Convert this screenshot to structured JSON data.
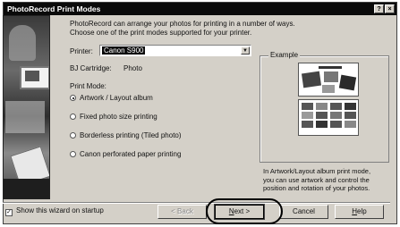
{
  "window": {
    "title": "PhotoRecord Print Modes",
    "help_glyph": "?",
    "close_glyph": "×"
  },
  "intro": {
    "line1": "PhotoRecord can arrange your photos for printing in a number of ways.",
    "line2": "Choose one of the print modes supported for your printer."
  },
  "printer": {
    "label": "Printer:",
    "value": "Canon S900",
    "arrow_glyph": "▼"
  },
  "cartridge": {
    "label": "BJ Cartridge:",
    "value": "Photo"
  },
  "print_mode": {
    "label": "Print Mode:",
    "options": [
      {
        "label": "Artwork / Layout album",
        "selected": true
      },
      {
        "label": "Fixed photo size printing",
        "selected": false
      },
      {
        "label": "Borderless printing (Tiled photo)",
        "selected": false
      },
      {
        "label": "Canon perforated paper printing",
        "selected": false
      }
    ]
  },
  "example": {
    "legend": "Example",
    "thumb_title_text": "",
    "explanation": [
      "In Artwork/Layout album print mode,",
      "you can use artwork and control the",
      "position and rotation of your photos."
    ]
  },
  "footer": {
    "show_wizard_label": "Show this wizard on startup",
    "show_wizard_checked": true,
    "check_glyph": "✓"
  },
  "buttons": {
    "back": "< Back",
    "next_prefix": "",
    "next_underlined": "N",
    "next_suffix": "ext >",
    "cancel": "Cancel",
    "help_underlined": "H",
    "help_suffix": "elp"
  }
}
